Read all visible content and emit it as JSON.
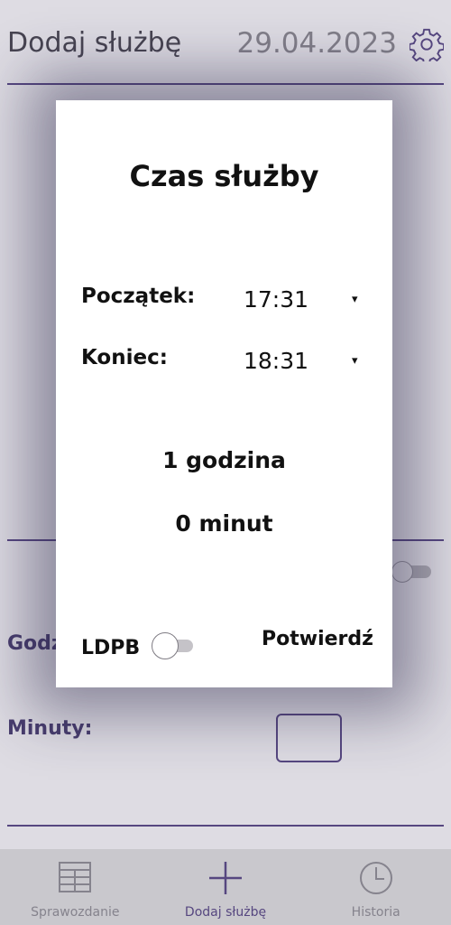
{
  "header": {
    "title": "Dodaj służbę",
    "date": "29.04.2023"
  },
  "background_form": {
    "hours_label": "Godz",
    "minutes_label": "Minuty:"
  },
  "dialog": {
    "title": "Czas służby",
    "start": {
      "label": "Początek:",
      "value": "17:31"
    },
    "end": {
      "label": "Koniec:",
      "value": "18:31"
    },
    "caret": "▾",
    "duration_hours": "1 godzina",
    "duration_minutes": "0 minut",
    "ldpb_label": "LDPB",
    "ldpb_enabled": false,
    "confirm_label": "Potwierdź"
  },
  "bottom_nav": {
    "items": [
      {
        "label": "Sprawozdanie",
        "icon": "table-icon",
        "active": false
      },
      {
        "label": "Dodaj służbę",
        "icon": "plus-icon",
        "active": true
      },
      {
        "label": "Historia",
        "icon": "clock-icon",
        "active": false
      }
    ]
  },
  "colors": {
    "accent": "#5b4a86",
    "nav_bg": "#d7d6d9",
    "dialog_bg": "#ffffff"
  }
}
